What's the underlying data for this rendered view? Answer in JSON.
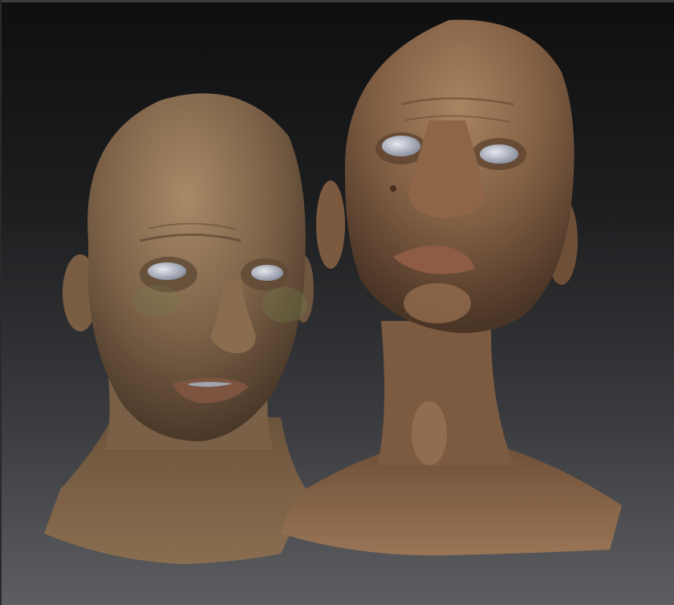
{
  "viewport": {
    "background_top": "#0f0f10",
    "background_bottom": "#5d5e61"
  },
  "models": [
    {
      "name": "head-left",
      "skin_color": "#8a6d4f",
      "eye_color": "#c9ccd6"
    },
    {
      "name": "head-right",
      "skin_color": "#8a6647",
      "eye_color": "#c9ccd6"
    }
  ]
}
